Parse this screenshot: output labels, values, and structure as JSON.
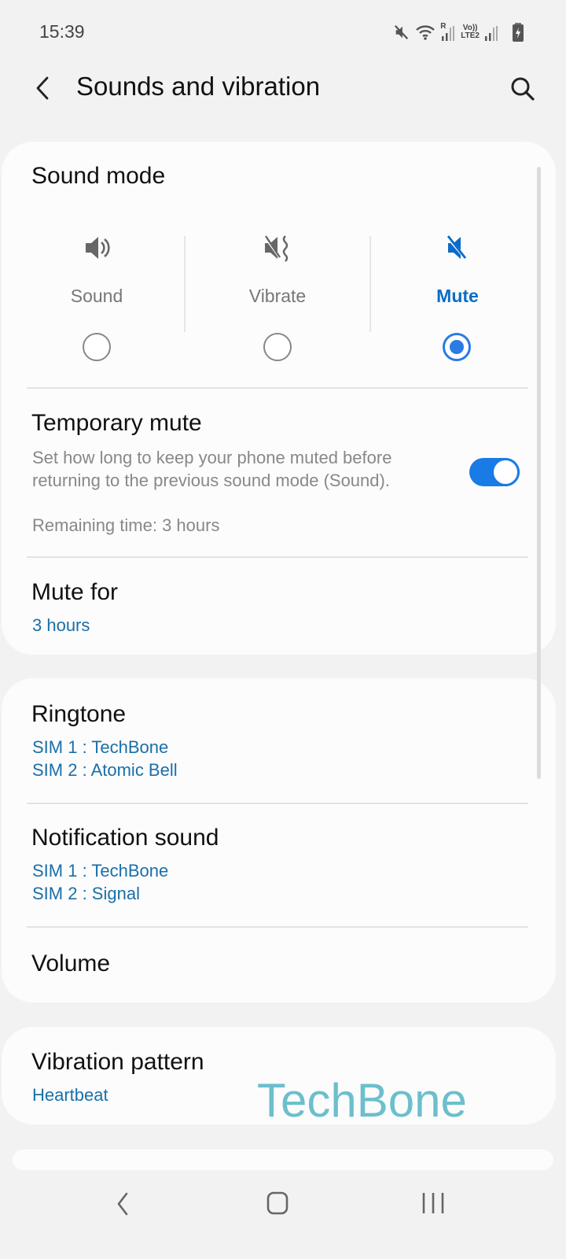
{
  "status_bar": {
    "time": "15:39",
    "icons": [
      "mute-icon",
      "wifi-icon",
      "sim1-signal-icon",
      "volte-lte2-signal-icon",
      "battery-charging-icon"
    ],
    "sim1_roaming_label": "R",
    "sim2_labels": [
      "Vo))",
      "LTE2"
    ]
  },
  "app_bar": {
    "title": "Sounds and vibration",
    "back_icon": "chevron-left-icon",
    "search_icon": "search-icon"
  },
  "sound_mode": {
    "title": "Sound mode",
    "options": [
      {
        "label": "Sound",
        "icon": "speaker-icon",
        "selected": false
      },
      {
        "label": "Vibrate",
        "icon": "vibrate-icon",
        "selected": false
      },
      {
        "label": "Mute",
        "icon": "mute-icon",
        "selected": true
      }
    ]
  },
  "temporary_mute": {
    "title": "Temporary mute",
    "description_line1": "Set how long to keep your phone muted before",
    "description_line2": "returning to the previous sound mode (Sound).",
    "remaining": "Remaining time: 3 hours",
    "enabled": true
  },
  "mute_for": {
    "title": "Mute for",
    "value": "3 hours"
  },
  "ringtone": {
    "title": "Ringtone",
    "sim1": "SIM 1 : TechBone",
    "sim2": "SIM 2 : Atomic Bell"
  },
  "notification_sound": {
    "title": "Notification sound",
    "sim1": "SIM 1 : TechBone",
    "sim2": "SIM 2 : Signal"
  },
  "volume": {
    "title": "Volume"
  },
  "vibration_pattern": {
    "title": "Vibration pattern",
    "value": "Heartbeat"
  },
  "watermark": "TechBone",
  "colors": {
    "accent": "#1a7ae6",
    "summary_blue": "#1a6fa8",
    "watermark": "#6cbfcc",
    "background": "#f2f2f2",
    "card": "#fcfcfc"
  },
  "nav_bar": {
    "buttons": [
      "back-icon",
      "home-icon",
      "recents-icon"
    ]
  }
}
